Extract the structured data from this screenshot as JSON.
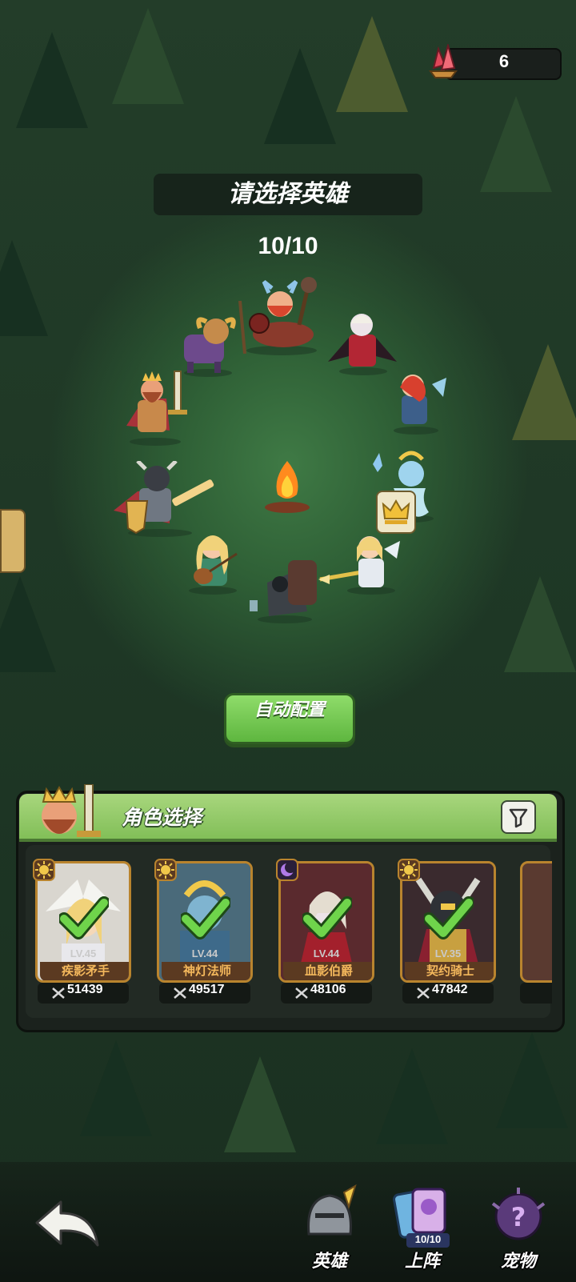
{
  "currency": {
    "icon": "red-crystal-icon",
    "amount": "6"
  },
  "title": "请选择英雄",
  "team_count": "10/10",
  "auto_button": "自动配置",
  "panel": {
    "title": "角色选择",
    "filter_icon": "filter-icon",
    "cards": [
      {
        "level": "LV.45",
        "name": "疾影矛手",
        "power": "51439",
        "element": "sun",
        "selected": true
      },
      {
        "level": "LV.44",
        "name": "神灯法师",
        "power": "49517",
        "element": "sun",
        "selected": true
      },
      {
        "level": "LV.44",
        "name": "血影伯爵",
        "power": "48106",
        "element": "moon",
        "selected": true
      },
      {
        "level": "LV.35",
        "name": "契约骑士",
        "power": "47842",
        "element": "sun",
        "selected": true
      }
    ]
  },
  "nav": {
    "back_icon": "back-arrow-icon",
    "heroes": "英雄",
    "lineup": "上阵",
    "lineup_badge": "10/10",
    "pets": "宠物"
  },
  "colors": {
    "accent_green": "#6fc94b",
    "card_border": "#b9842e",
    "name_text": "#f4b85c"
  }
}
